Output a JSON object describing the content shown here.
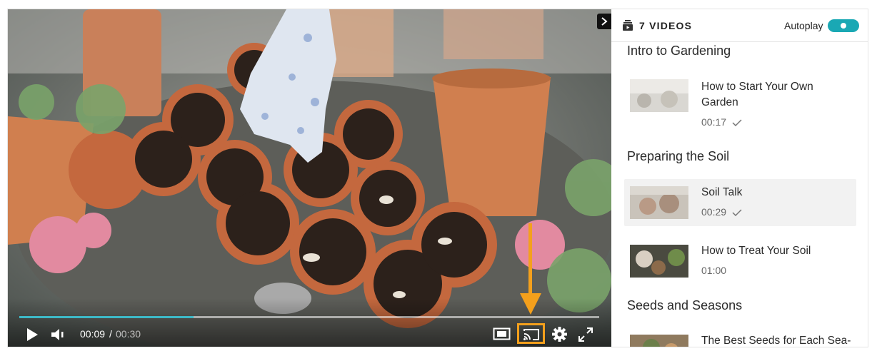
{
  "player": {
    "current_time": "00:09",
    "separator": "/",
    "duration": "00:30",
    "progress": 0.3
  },
  "sidebar": {
    "count_label": "7 VIDEOS",
    "autoplay_label": "Autoplay",
    "autoplay_on": true,
    "sections": [
      {
        "title": "Intro to Gardening",
        "lessons": [
          {
            "title": "How to Start Your Own Garden",
            "duration": "00:17",
            "watched": true
          }
        ]
      },
      {
        "title": "Preparing the Soil",
        "lessons": [
          {
            "title": "Soil Talk",
            "duration": "00:29",
            "watched": true,
            "active": true
          },
          {
            "title": "How to Treat Your Soil",
            "duration": "01:00",
            "watched": false
          }
        ]
      },
      {
        "title": "Seeds and Seasons",
        "lessons": [
          {
            "title": "The Best Seeds for Each Sea-",
            "duration": "",
            "watched": false
          }
        ]
      }
    ]
  },
  "colors": {
    "accent": "#1aa8b4",
    "progress": "#3db9c7",
    "highlight": "#f4a01c"
  },
  "icons": {
    "collapse": "chevron-right-icon",
    "play": "play-icon",
    "volume": "volume-icon",
    "pip": "picture-in-picture-icon",
    "cast": "cast-icon",
    "settings": "gear-icon",
    "fullscreen": "fullscreen-icon",
    "playlist": "playlist-icon",
    "watched": "checkmark-icon"
  }
}
